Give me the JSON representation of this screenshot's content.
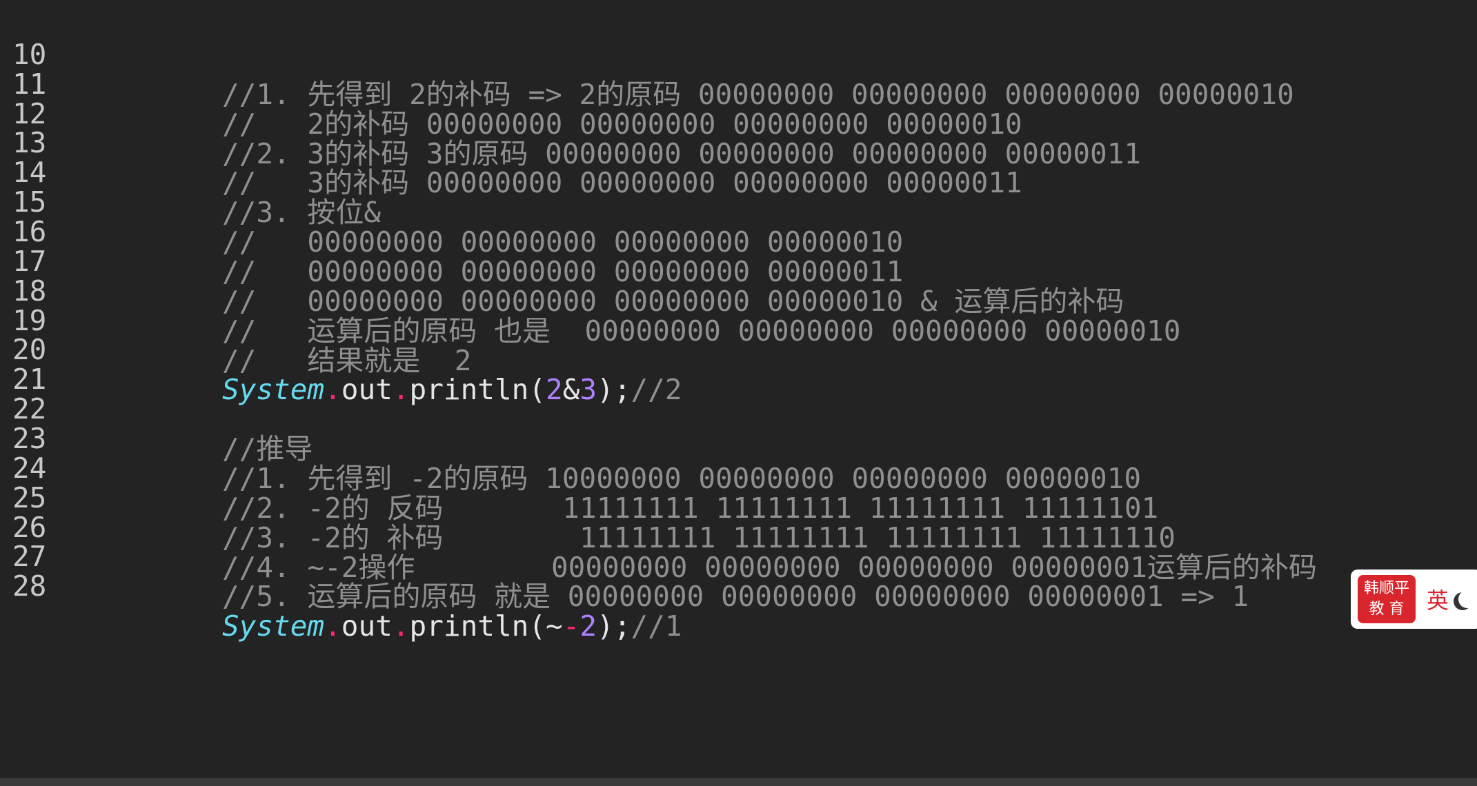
{
  "editor": {
    "lines": [
      {
        "num": "10",
        "text": "//1. 先得到 2的补码 => 2的原码 00000000 00000000 00000000 00000010"
      },
      {
        "num": "11",
        "text": "//   2的补码 00000000 00000000 00000000 00000010"
      },
      {
        "num": "12",
        "text": "//2. 3的补码 3的原码 00000000 00000000 00000000 00000011"
      },
      {
        "num": "13",
        "text": "//   3的补码 00000000 00000000 00000000 00000011"
      },
      {
        "num": "14",
        "text": "//3. 按位&"
      },
      {
        "num": "15",
        "text": "//   00000000 00000000 00000000 00000010"
      },
      {
        "num": "16",
        "text": "//   00000000 00000000 00000000 00000011"
      },
      {
        "num": "17",
        "text": "//   00000000 00000000 00000000 00000010 & 运算后的补码"
      },
      {
        "num": "18",
        "text": "//   运算后的原码 也是  00000000 00000000 00000000 00000010"
      },
      {
        "num": "19",
        "text": "//   结果就是  2"
      },
      {
        "num": "20",
        "tokens": {
          "cls": "System",
          "dot1": ".",
          "out": "out",
          "dot2": ".",
          "call": "println(",
          "n1": "2",
          "op": "&",
          "n2": "3",
          "close": ");",
          "comment": "//2"
        }
      },
      {
        "num": "21",
        "text": ""
      },
      {
        "num": "22",
        "text": "//推导"
      },
      {
        "num": "23",
        "text": "//1. 先得到 -2的原码 10000000 00000000 00000000 00000010"
      },
      {
        "num": "24",
        "text": "//2. -2的 反码       11111111 11111111 11111111 11111101"
      },
      {
        "num": "25",
        "text": "//3. -2的 补码        11111111 11111111 11111111 11111110"
      },
      {
        "num": "26",
        "text": "//4. ~-2操作        00000000 00000000 00000000 00000001运算后的补码"
      },
      {
        "num": "27",
        "text": "//5. 运算后的原码 就是 00000000 00000000 00000000 00000001 => 1"
      },
      {
        "num": "28",
        "tokens": {
          "cls": "System",
          "dot1": ".",
          "out": "out",
          "dot2": ".",
          "call": "println(",
          "op": "~",
          "neg": "-",
          "n1": "2",
          "close": ");",
          "comment": "//1"
        }
      }
    ]
  },
  "watermark": {
    "brand_line1": "韩顺平",
    "brand_line2": "教 育",
    "ime_language": "英",
    "moon_icon": "moon-icon"
  },
  "colors": {
    "background": "#232323",
    "comment": "#8f8f8f",
    "class": "#66d9ef",
    "operator": "#f92672",
    "number": "#ae81ff",
    "brand_red": "#d9262c"
  }
}
